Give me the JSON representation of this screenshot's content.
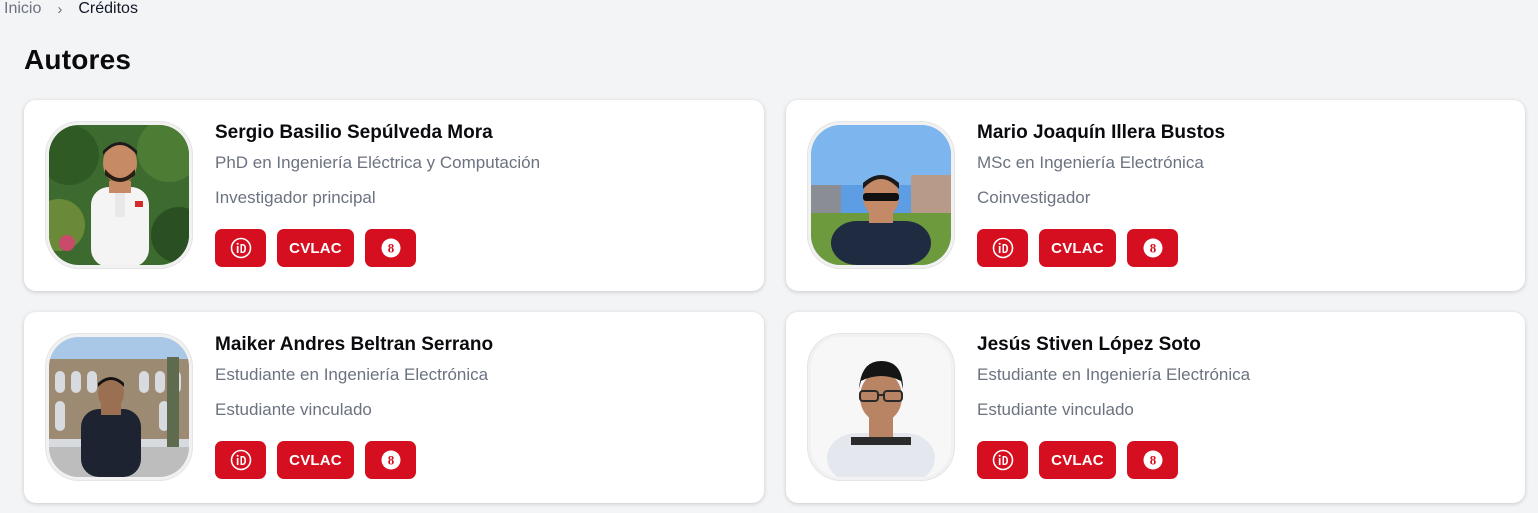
{
  "breadcrumb": {
    "home": "Inicio",
    "separator": "›",
    "current": "Créditos"
  },
  "section_title": "Autores",
  "accent_color": "#d50f1f",
  "authors": [
    {
      "name": "Sergio Basilio Sepúlveda Mora",
      "degree": "PhD en Ingeniería Eléctrica y Computación",
      "role": "Investigador principal",
      "links": {
        "orcid_icon": "orcid-icon",
        "cvlac_label": "CVLAC",
        "scholar_icon": "google-scholar-icon"
      }
    },
    {
      "name": "Mario Joaquín Illera Bustos",
      "degree": "MSc en Ingeniería Electrónica",
      "role": "Coinvestigador",
      "links": {
        "orcid_icon": "orcid-icon",
        "cvlac_label": "CVLAC",
        "scholar_icon": "google-scholar-icon"
      }
    },
    {
      "name": "Maiker Andres Beltran Serrano",
      "degree": "Estudiante en Ingeniería Electrónica",
      "role": "Estudiante vinculado",
      "links": {
        "orcid_icon": "orcid-icon",
        "cvlac_label": "CVLAC",
        "scholar_icon": "google-scholar-icon"
      }
    },
    {
      "name": "Jesús Stiven López Soto",
      "degree": "Estudiante en Ingeniería Electrónica",
      "role": "Estudiante vinculado",
      "links": {
        "orcid_icon": "orcid-icon",
        "cvlac_label": "CVLAC",
        "scholar_icon": "google-scholar-icon"
      }
    }
  ]
}
